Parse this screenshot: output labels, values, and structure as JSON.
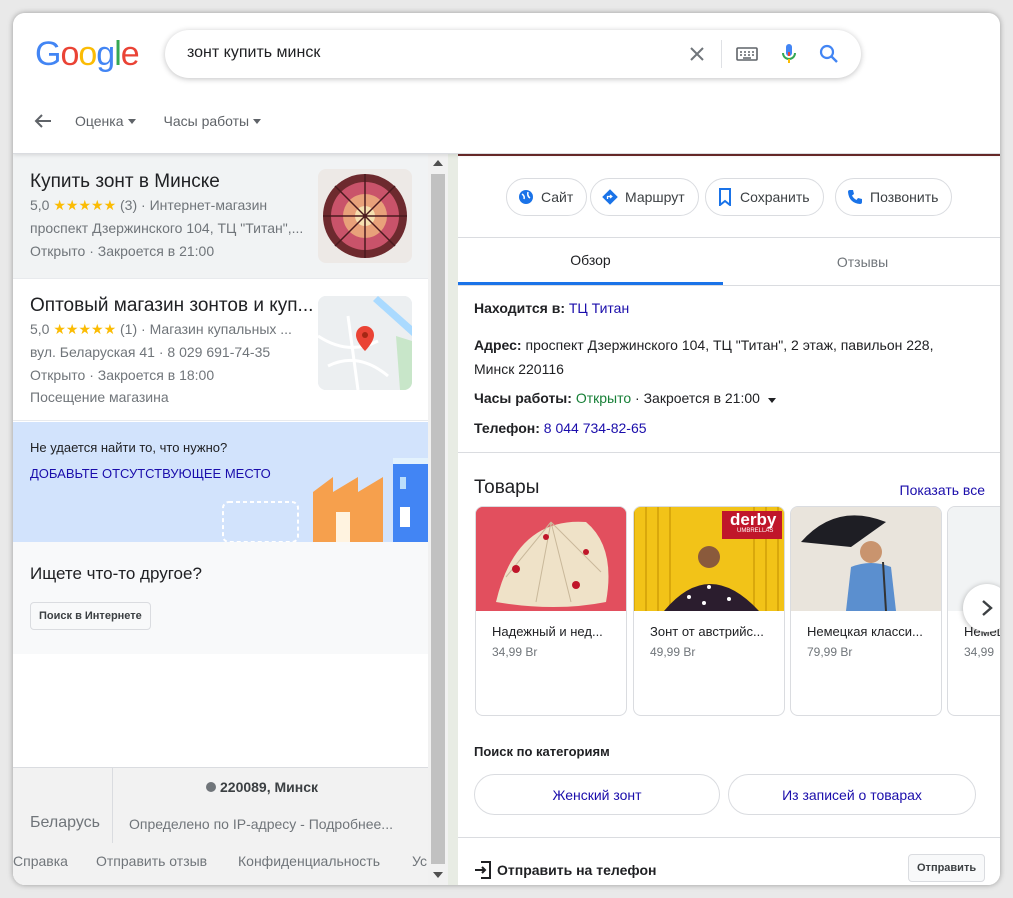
{
  "header": {
    "search_query": "зонт купить минск",
    "filters": [
      "Оценка",
      "Часы работы"
    ]
  },
  "results": [
    {
      "title": "Купить зонт в Минске",
      "rating": "5,0",
      "stars": "★★★★★",
      "reviews": "(3)",
      "category": "· Интернет-магазин",
      "address": "проспект Дзержинского 104, ТЦ \"Титан\",...",
      "hours": "Открыто · Закроется в 21:00"
    },
    {
      "title": "Оптовый магазин зонтов и куп...",
      "rating": "5,0",
      "stars": "★★★★★",
      "reviews": "(1)",
      "category": "· Магазин купальных ...",
      "address": "вул. Беларуская 41 · 8 029 691-74-35",
      "hours": "Открыто · Закроется в 18:00",
      "extra": "Посещение магазина"
    }
  ],
  "not_found": {
    "question": "Не удается найти то, что нужно?",
    "link": "ДОБАВЬТЕ ОТСУТСТВУЮЩЕЕ МЕСТО"
  },
  "other": {
    "title": "Ищете что-то другое?",
    "button": "Поиск в Интернете"
  },
  "footer": {
    "country": "Беларусь",
    "location": "220089, Минск",
    "location_note": "Определено по IP-адресу - Подробнее...",
    "links": [
      "Справка",
      "Отправить отзыв",
      "Конфиденциальность",
      "Ус"
    ]
  },
  "place": {
    "actions": [
      "Сайт",
      "Маршрут",
      "Сохранить",
      "Позвонить"
    ],
    "tabs": [
      "Обзор",
      "Отзывы"
    ],
    "located_in_label": "Находится в:",
    "located_in": "ТЦ Титан",
    "address_label": "Адрес:",
    "address_line1": "проспект Дзержинского 104, ТЦ \"Титан\", 2 этаж, павильон 228,",
    "address_line2": "Минск 220116",
    "hours_label": "Часы работы:",
    "hours_open": "Открыто",
    "hours_rest": "· Закроется в 21:00",
    "phone_label": "Телефон:",
    "phone": "8 044 734-82-65"
  },
  "goods": {
    "title": "Товары",
    "show_all": "Показать все",
    "items": [
      {
        "name": "Надежный и нед...",
        "price": "34,99 Br"
      },
      {
        "name": "Зонт от австрийс...",
        "price": "49,99 Br"
      },
      {
        "name": "Немецкая класси...",
        "price": "79,99 Br"
      },
      {
        "name": "Немец",
        "price": "34,99"
      }
    ],
    "brand_badge": "derby",
    "brand_sub": "UMBRELLAS"
  },
  "categories": {
    "title": "Поиск по категориям",
    "chips": [
      "Женский зонт",
      "Из записей о товарах"
    ]
  },
  "send": {
    "label": "Отправить на телефон",
    "button": "Отправить"
  },
  "colors": {
    "link": "#1a0dab",
    "open": "#188038",
    "accent": "#1a73e8",
    "stars": "#fbbc04"
  }
}
